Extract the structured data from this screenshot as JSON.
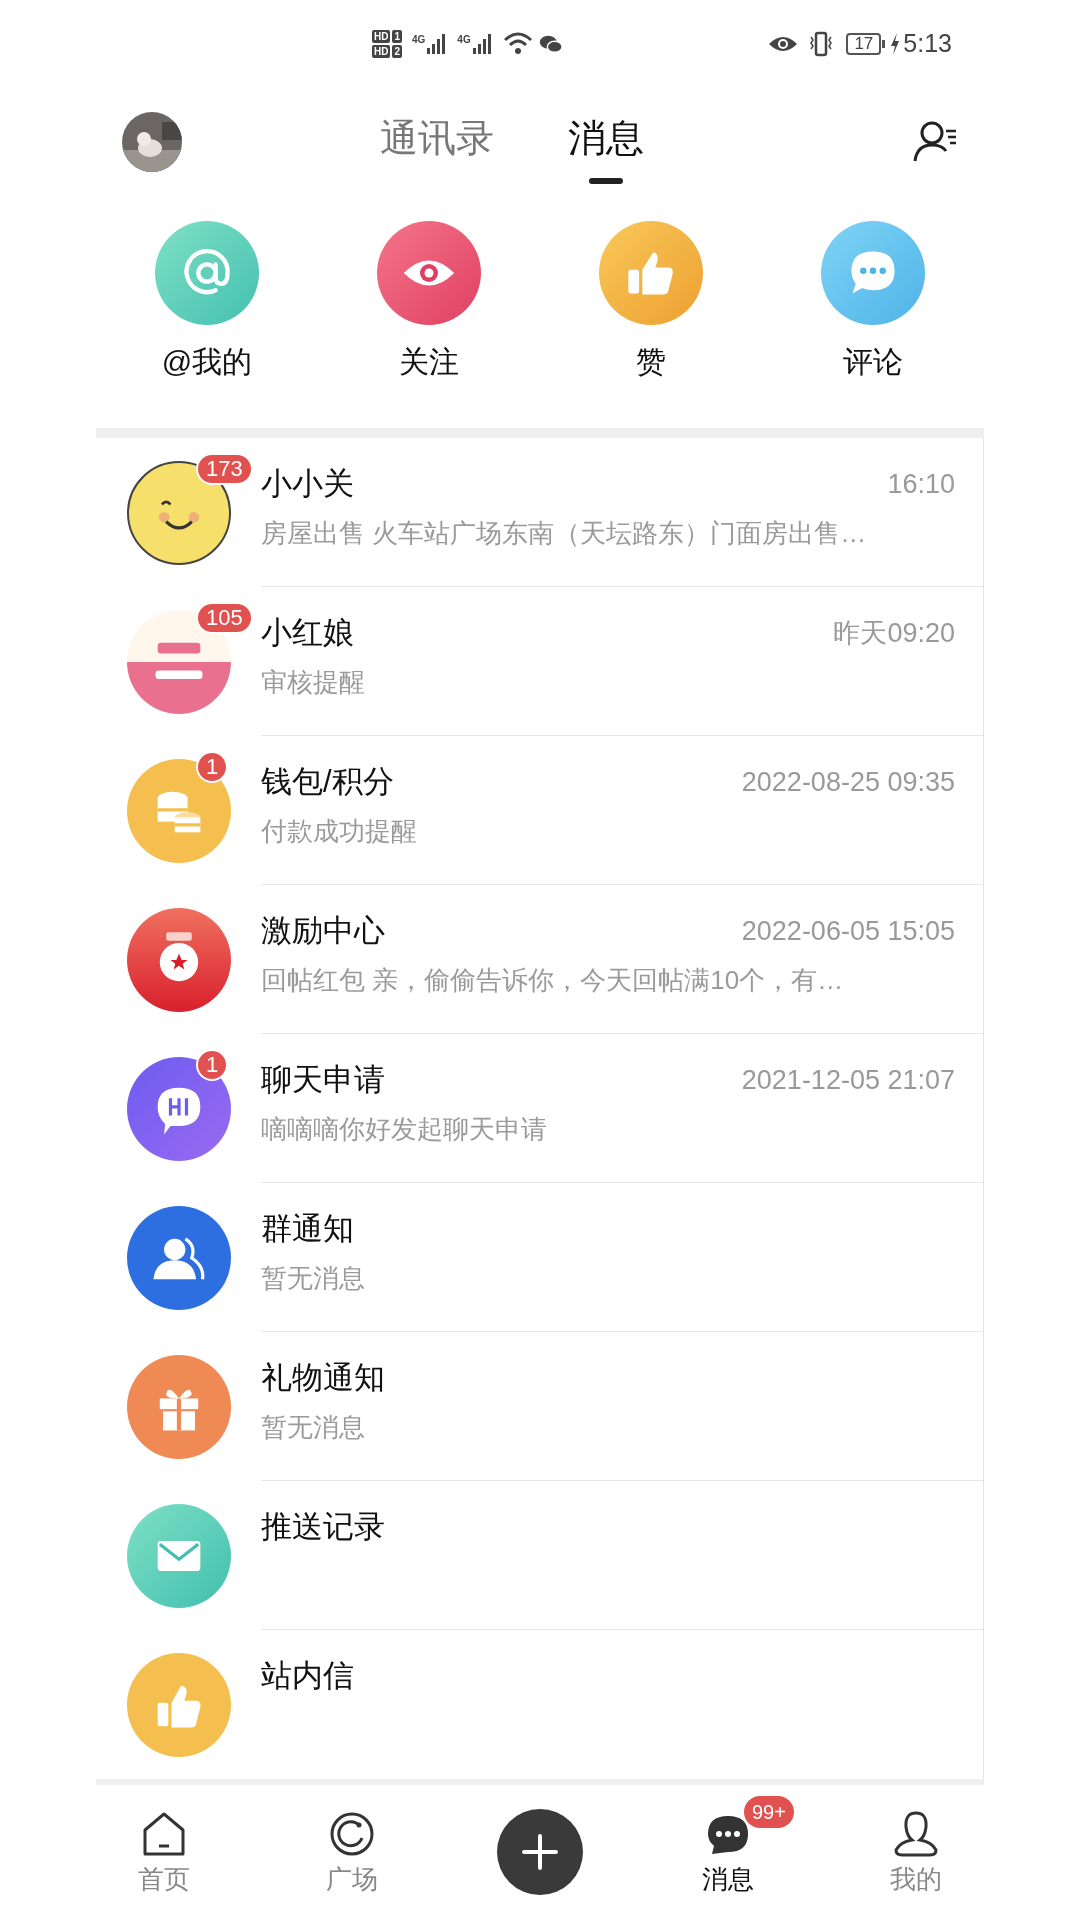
{
  "status_bar": {
    "sim_labels": [
      {
        "label": "HD",
        "slot": "1"
      },
      {
        "label": "HD",
        "slot": "2"
      }
    ],
    "network": [
      "4G",
      "4G"
    ],
    "battery": "17",
    "time": "5:13"
  },
  "header": {
    "tabs": [
      {
        "label": "通讯录",
        "selected": false
      },
      {
        "label": "消息",
        "selected": true
      }
    ]
  },
  "shortcuts": [
    {
      "kind": "at",
      "label": "@我的"
    },
    {
      "kind": "eye",
      "label": "关注"
    },
    {
      "kind": "like",
      "label": "赞"
    },
    {
      "kind": "comment",
      "label": "评论"
    }
  ],
  "conversations": [
    {
      "kind": "smiley",
      "name": "小小关",
      "preview": "房屋出售 火车站广场东南（天坛路东）门面房出售…",
      "time": "16:10",
      "badge": "173"
    },
    {
      "kind": "logo",
      "name": "小红娘",
      "preview": "审核提醒",
      "time": "昨天09:20",
      "badge": "105"
    },
    {
      "kind": "coins",
      "name": "钱包/积分",
      "preview": "付款成功提醒",
      "time": "2022-08-25 09:35",
      "badge": "1"
    },
    {
      "kind": "medal",
      "name": "激励中心",
      "preview": "回帖红包 亲，偷偷告诉你，今天回帖满10个，有…",
      "time": "2022-06-05 15:05"
    },
    {
      "kind": "chat",
      "name": "聊天申请",
      "preview": "嘀嘀嘀你好发起聊天申请",
      "time": "2021-12-05 21:07",
      "badge": "1"
    },
    {
      "kind": "group",
      "name": "群通知",
      "preview": "暂无消息"
    },
    {
      "kind": "gift",
      "name": "礼物通知",
      "preview": "暂无消息"
    },
    {
      "kind": "mail",
      "name": "推送记录"
    },
    {
      "kind": "thumb",
      "name": "站内信"
    }
  ],
  "bottom_nav": [
    {
      "kind": "home",
      "label": "首页",
      "selected": false
    },
    {
      "kind": "plaza",
      "label": "广场",
      "selected": false
    },
    {
      "kind": "add"
    },
    {
      "kind": "messages",
      "label": "消息",
      "selected": true,
      "badge": "99+"
    },
    {
      "kind": "me",
      "label": "我的",
      "selected": false
    }
  ]
}
